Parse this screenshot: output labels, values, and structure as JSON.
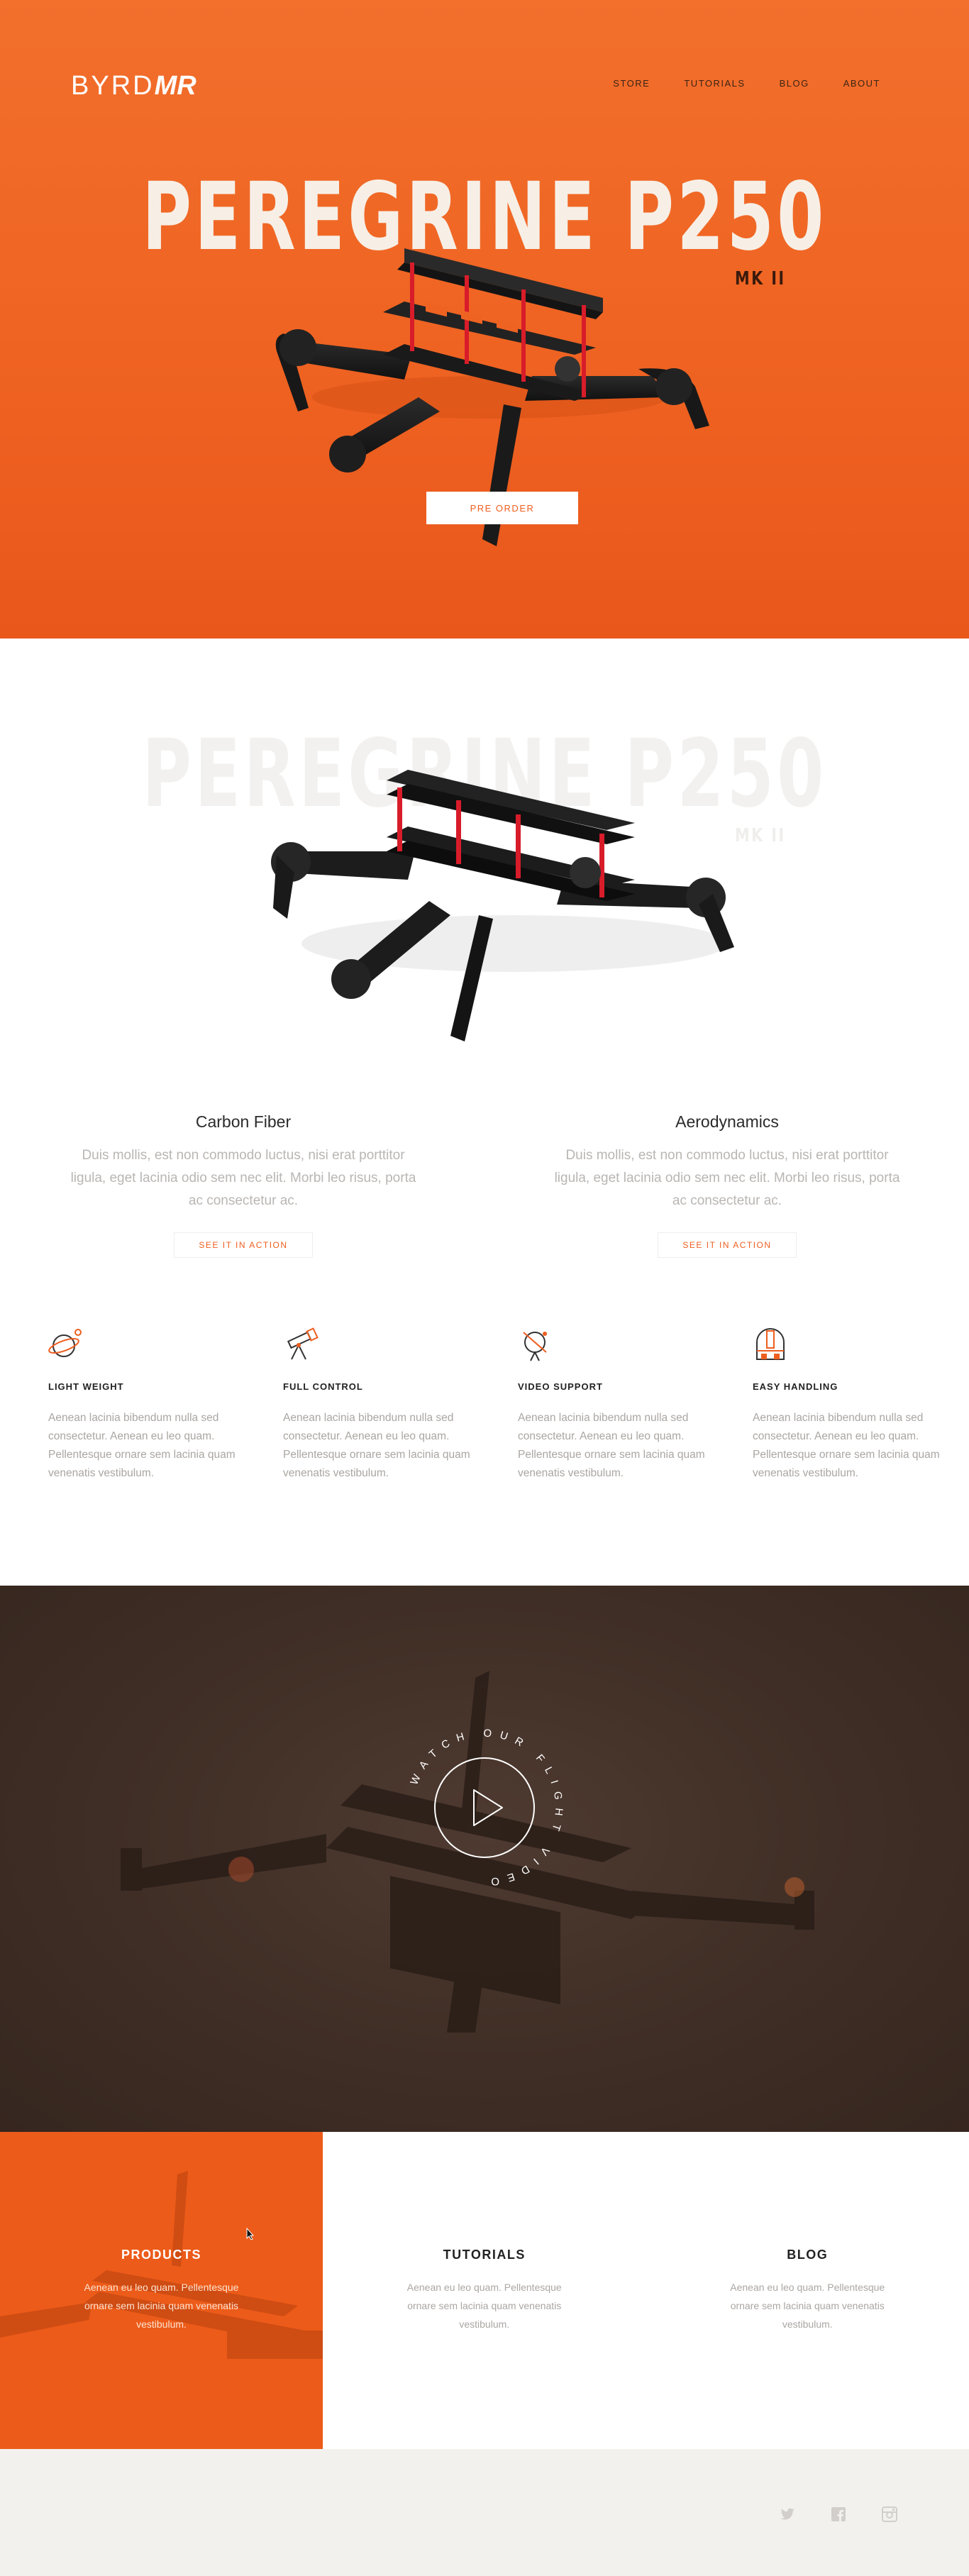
{
  "brand": {
    "logo_main": "BYRD",
    "logo_accent": "MR"
  },
  "nav": {
    "items": [
      "STORE",
      "TUTORIALS",
      "BLOG",
      "ABOUT"
    ]
  },
  "hero": {
    "title": "PEREGRINE P250",
    "subtitle": "MK II",
    "cta": "PRE ORDER"
  },
  "product": {
    "ghost_title": "PEREGRINE P250",
    "ghost_subtitle": "MK II",
    "features": [
      {
        "title": "Carbon Fiber",
        "text": "Duis mollis, est non commodo luctus, nisi erat porttitor ligula, eget lacinia odio sem nec elit. Morbi leo risus, porta ac consectetur ac.",
        "button": "SEE IT IN ACTION"
      },
      {
        "title": "Aerodynamics",
        "text": "Duis mollis, est non commodo luctus, nisi erat porttitor ligula, eget lacinia odio sem nec elit. Morbi leo risus, porta ac consectetur ac.",
        "button": "SEE IT IN ACTION"
      }
    ],
    "properties": [
      {
        "icon": "planet-icon",
        "title": "LIGHT WEIGHT",
        "text": "Aenean lacinia bibendum nulla sed consectetur. Aenean eu leo quam. Pellentesque ornare sem lacinia quam venenatis vestibulum."
      },
      {
        "icon": "telescope-icon",
        "title": "FULL CONTROL",
        "text": "Aenean lacinia bibendum nulla sed consectetur. Aenean eu leo quam. Pellentesque ornare sem lacinia quam venenatis vestibulum."
      },
      {
        "icon": "satellite-icon",
        "title": "VIDEO SUPPORT",
        "text": "Aenean lacinia bibendum nulla sed consectetur. Aenean eu leo quam. Pellentesque ornare sem lacinia quam venenatis vestibulum."
      },
      {
        "icon": "observatory-icon",
        "title": "EASY HANDLING",
        "text": "Aenean lacinia bibendum nulla sed consectetur. Aenean eu leo quam. Pellentesque ornare sem lacinia quam venenatis vestibulum."
      }
    ]
  },
  "video": {
    "ring_text": "WATCH OUR FLIGHT VIDEO"
  },
  "tiles": [
    {
      "title": "PRODUCTS",
      "text": "Aenean eu leo quam. Pellentesque ornare sem lacinia quam venenatis vestibulum."
    },
    {
      "title": "TUTORIALS",
      "text": "Aenean eu leo quam. Pellentesque ornare sem lacinia quam venenatis vestibulum."
    },
    {
      "title": "BLOG",
      "text": "Aenean eu leo quam. Pellentesque ornare sem lacinia quam venenatis vestibulum."
    }
  ],
  "footer": {
    "social": [
      "twitter-icon",
      "facebook-icon",
      "instagram-icon"
    ]
  },
  "colors": {
    "accent": "#ee5e1f",
    "dark": "#3f2e25",
    "footer_bg": "#f3f1ee"
  }
}
